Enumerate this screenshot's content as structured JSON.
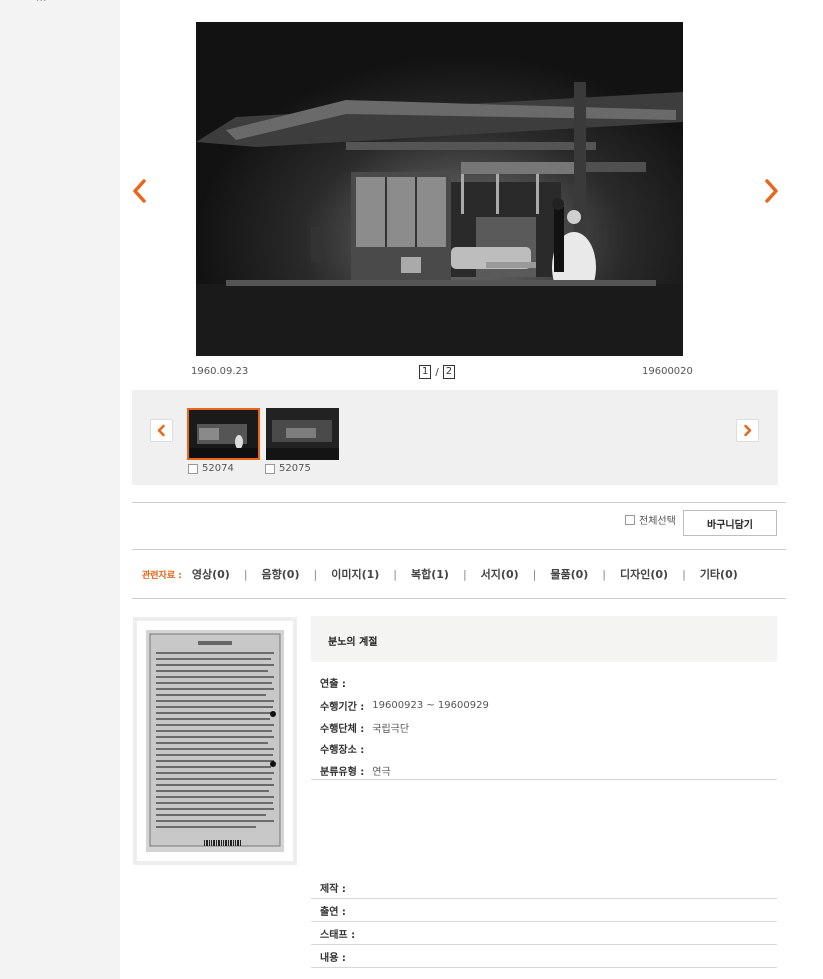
{
  "photo": {
    "date": "1960.09.23",
    "id": "19600020",
    "page_current": "1",
    "page_separator": "/",
    "page_total": "2"
  },
  "thumbnails": [
    {
      "label": "52074",
      "selected": true
    },
    {
      "label": "52075",
      "selected": false
    }
  ],
  "actions": {
    "select_all_label": "전체선택",
    "basket_label": "바구니담기"
  },
  "related": {
    "label": "관련자료 :",
    "items": [
      {
        "label": "영상(0)"
      },
      {
        "label": "음향(0)"
      },
      {
        "label": "이미지(1)"
      },
      {
        "label": "복합(1)"
      },
      {
        "label": "서지(0)"
      },
      {
        "label": "물품(0)"
      },
      {
        "label": "디자인(0)"
      },
      {
        "label": "기타(0)"
      }
    ]
  },
  "record": {
    "title": "분노의 계절",
    "fields_top": [
      {
        "key": "연출 :",
        "value": ""
      },
      {
        "key": "수행기간 :",
        "value": "19600923 ~ 19600929"
      },
      {
        "key": "수행단체 :",
        "value": "국립극단"
      },
      {
        "key": "수행장소 :",
        "value": ""
      },
      {
        "key": "분류유형 :",
        "value": "연극"
      }
    ],
    "fields_bottom": [
      {
        "key": "제작 :",
        "value": ""
      },
      {
        "key": "출연 :",
        "value": ""
      },
      {
        "key": "스태프 :",
        "value": ""
      },
      {
        "key": "내용 :",
        "value": ""
      }
    ]
  },
  "colors": {
    "accent": "#e8671c",
    "panel": "#f0f0f0",
    "rail": "#f3f3f3"
  },
  "icons": {
    "prev": "chevron-left-icon",
    "next": "chevron-right-icon"
  }
}
